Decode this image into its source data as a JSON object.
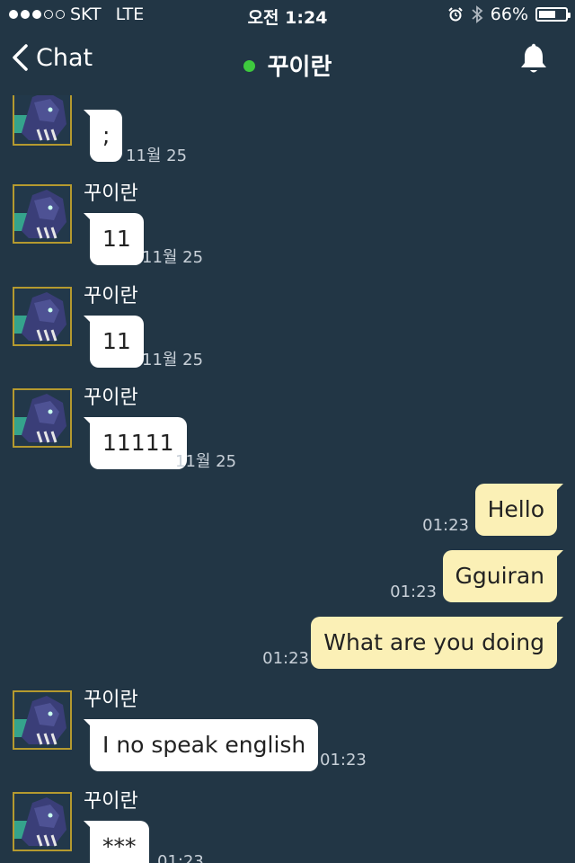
{
  "status_bar": {
    "carrier": "SKT",
    "network": "LTE",
    "time": "오전 1:24",
    "battery_percent": "66%",
    "battery_level": 0.66,
    "signal_bars_filled": 3,
    "signal_bars_total": 5
  },
  "nav": {
    "back_label": "Chat",
    "title": "꾸이란",
    "online_color": "#3ec93e",
    "bell_icon": "bell-icon"
  },
  "colors": {
    "background": "#223645",
    "incoming_bubble": "#ffffff",
    "outgoing_bubble": "#fbf0b6",
    "avatar_border": "#b59a2f"
  },
  "messages": [
    {
      "direction": "in",
      "sender": "꾸이란",
      "text": ";",
      "time": "11월 25"
    },
    {
      "direction": "in",
      "sender": "꾸이란",
      "text": "11",
      "time": "11월 25"
    },
    {
      "direction": "in",
      "sender": "꾸이란",
      "text": "11",
      "time": "11월 25"
    },
    {
      "direction": "in",
      "sender": "꾸이란",
      "text": "11111",
      "time": "11월 25"
    },
    {
      "direction": "out",
      "text": "Hello",
      "time": "01:23"
    },
    {
      "direction": "out",
      "text": "Gguiran",
      "time": "01:23"
    },
    {
      "direction": "out",
      "text": "What are you doing",
      "time": "01:23"
    },
    {
      "direction": "in",
      "sender": "꾸이란",
      "text": "I no speak english",
      "time": "01:23"
    },
    {
      "direction": "in",
      "sender": "꾸이란",
      "text": "***",
      "time": "01:23"
    }
  ]
}
